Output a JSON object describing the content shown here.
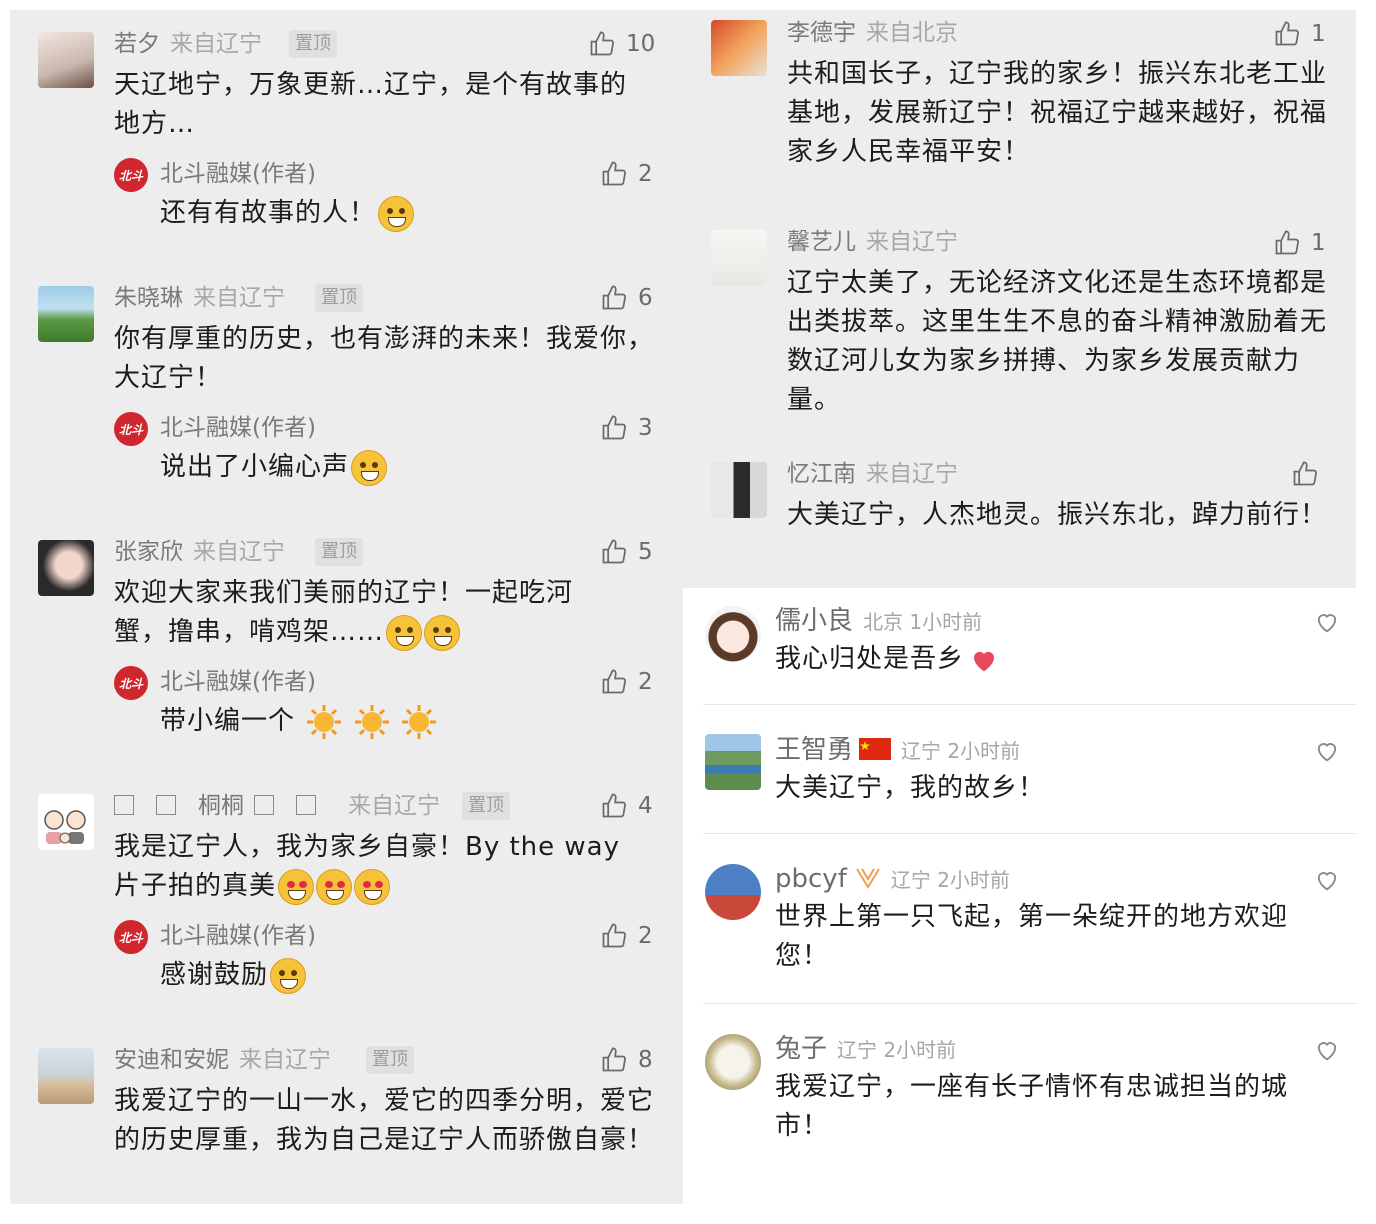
{
  "left": {
    "comments": [
      {
        "name": "若夕",
        "origin": "来自辽宁",
        "pin": "置顶",
        "likes": "10",
        "text": "天辽地宁，万象更新…辽宁，是个有故事的地方…",
        "reply": {
          "name": "北斗融媒(作者)",
          "likes": "2",
          "text": "还有有故事的人！"
        }
      },
      {
        "name": "朱晓琳",
        "origin": "来自辽宁",
        "pin": "置顶",
        "likes": "6",
        "text": "你有厚重的历史，也有澎湃的未来！我爱你，大辽宁！",
        "reply": {
          "name": "北斗融媒(作者)",
          "likes": "3",
          "text": "说出了小编心声"
        }
      },
      {
        "name": "张家欣",
        "origin": "来自辽宁",
        "pin": "置顶",
        "likes": "5",
        "text": "欢迎大家来我们美丽的辽宁！一起吃河蟹，撸串，啃鸡架……",
        "reply": {
          "name": "北斗融媒(作者)",
          "likes": "2",
          "text": "带小编一个"
        }
      },
      {
        "name": "桐桐",
        "origin": "来自辽宁",
        "pin": "置顶",
        "likes": "4",
        "text": "我是辽宁人，我为家乡自豪！By the way 片子拍的真美",
        "reply": {
          "name": "北斗融媒(作者)",
          "likes": "2",
          "text": "感谢鼓励"
        }
      },
      {
        "name": "安迪和安妮",
        "origin": "来自辽宁",
        "pin": "置顶",
        "likes": "8",
        "text": "我爱辽宁的一山一水，爱它的四季分明，爱它的历史厚重，我为自己是辽宁人而骄傲自豪！"
      }
    ],
    "author_logo": "北斗"
  },
  "right_top": {
    "comments": [
      {
        "name": "李德宇",
        "origin": "来自北京",
        "likes": "1",
        "text": "共和国长子，辽宁我的家乡！振兴东北老工业基地，发展新辽宁！祝福辽宁越来越好，祝福家乡人民幸福平安！"
      },
      {
        "name": "馨艺儿",
        "origin": "来自辽宁",
        "likes": "1",
        "text": "辽宁太美了，无论经济文化还是生态环境都是出类拔萃。这里生生不息的奋斗精神激励着无数辽河儿女为家乡拼搏、为家乡发展贡献力量。"
      },
      {
        "name": "忆江南",
        "origin": "来自辽宁",
        "likes": "",
        "text": "大美辽宁，人杰地灵。振兴东北，踔力前行！"
      }
    ]
  },
  "right_bottom": {
    "comments": [
      {
        "name": "儒小良",
        "meta": "北京 1小时前",
        "text": "我心归处是吾乡"
      },
      {
        "name": "王智勇",
        "meta": "辽宁 2小时前",
        "text": "大美辽宁，我的故乡！"
      },
      {
        "name": "pbcyf",
        "meta": "辽宁 2小时前",
        "text": "世界上第一只飞起，第一朵绽开的地方欢迎您！"
      },
      {
        "name": "兔子",
        "meta": "辽宁 2小时前",
        "text": "我爱辽宁，一座有长子情怀有忠诚担当的城市！"
      }
    ]
  },
  "colors": {
    "panel_bg": "#ededed",
    "author_red": "#d0262d",
    "text": "#1c1c1c",
    "meta": "#a8a8a8"
  },
  "icons": {
    "like": "thumbs-up-icon",
    "heart": "heart-icon"
  }
}
